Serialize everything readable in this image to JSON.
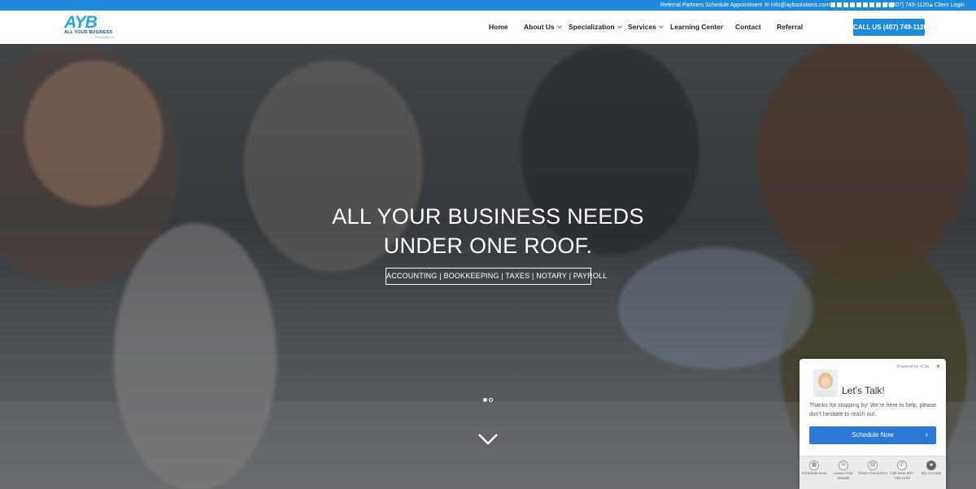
{
  "topbar": {
    "referral_partners": "Referral Partners",
    "schedule_appointment": "Schedule Appointment",
    "email": "info@aybsolutions.com",
    "phone": "(407) 749-1120",
    "client_login": "Client Login",
    "social_icons": [
      "twitter-icon",
      "facebook-icon",
      "linkedin-icon",
      "google-plus-icon",
      "yelp-icon",
      "blogger-icon",
      "rss-icon",
      "chat-icon",
      "feed-icon",
      "pinterest-icon"
    ]
  },
  "header": {
    "logo_mark": "AYB",
    "logo_sub": "ALL YOUR BUSINESS",
    "logo_sub2": "SOLUTIONS LLC",
    "nav": [
      {
        "label": "Home"
      },
      {
        "label": "About Us"
      },
      {
        "label": "Specialization"
      },
      {
        "label": "Services"
      },
      {
        "label": "Learning Center"
      },
      {
        "label": "Contact"
      },
      {
        "label": "Referral"
      }
    ],
    "cta": "CALL US (407) 749-1120"
  },
  "hero": {
    "title_line1": "ALL YOUR BUSINESS NEEDS",
    "title_line2": "UNDER ONE ROOF.",
    "services": "ACCOUNTING | BOOKKEEPING | TAXES | NOTARY | PAYROLL"
  },
  "chat": {
    "powered": "Powered by vCita",
    "close": "×",
    "title": "Let's Talk!",
    "message": "Thanks for stopping by! We're here to help, please don't hesitate to reach out.",
    "button": "Schedule Now",
    "footer": [
      {
        "label": "Schedule Now",
        "icon": "calendar-icon"
      },
      {
        "label": "Leave Your Details",
        "icon": "envelope-icon"
      },
      {
        "label": "Share Document",
        "icon": "document-icon"
      },
      {
        "label": "Call Now 407-749-1120",
        "icon": "phone-icon"
      },
      {
        "label": "My Account",
        "icon": "user-icon"
      }
    ]
  },
  "colors": {
    "accent": "#1f8ad9",
    "chat_button": "#2b79d4"
  }
}
